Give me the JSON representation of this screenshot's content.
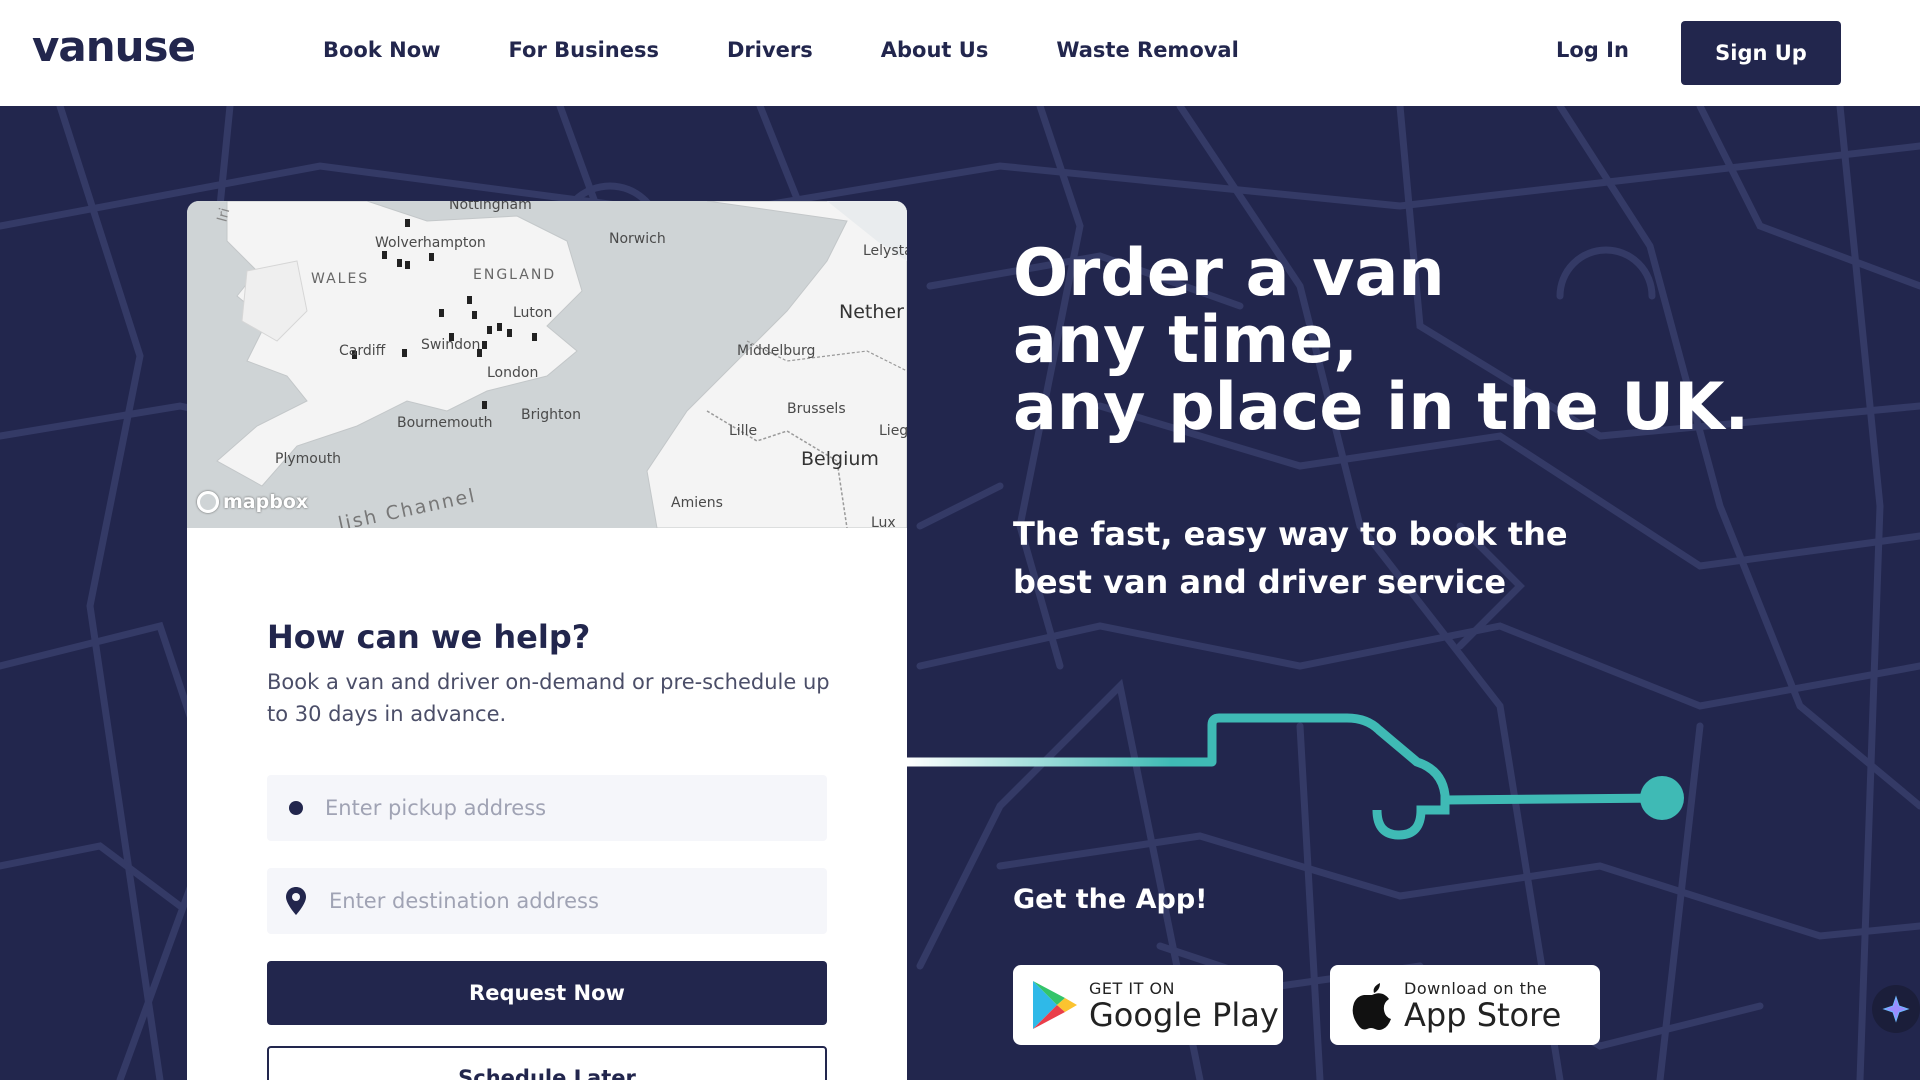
{
  "brand": {
    "logo": "vanuse"
  },
  "nav": {
    "items": [
      "Book Now",
      "For Business",
      "Drivers",
      "About Us",
      "Waste Removal"
    ],
    "login": "Log In",
    "signup": "Sign Up"
  },
  "map": {
    "labels": {
      "nottingham": "Nottingham",
      "wolverhampton": "Wolverhampton",
      "norwich": "Norwich",
      "lelystad": "Lelysta",
      "wales": "WALES",
      "england": "ENGLAND",
      "luton": "Luton",
      "netherlands": "Nether",
      "cardiff": "Cardiff",
      "swindon": "Swindon",
      "london": "London",
      "middelburg": "Middelburg",
      "brussels": "Brussels",
      "lille": "Lille",
      "liege": "Lieg",
      "belgium": "Belgium",
      "bournemouth": "Bournemouth",
      "brighton": "Brighton",
      "plymouth": "Plymouth",
      "channel": "lish Channel",
      "amiens": "Amiens",
      "lux": "Lux",
      "irish": "Iri"
    },
    "attribution": "mapbox"
  },
  "form": {
    "title": "How can we help?",
    "subtitle": "Book a van and driver on-demand or pre-schedule up to 30 days in advance.",
    "pickup_placeholder": "Enter pickup address",
    "destination_placeholder": "Enter destination address",
    "request_label": "Request Now",
    "schedule_label": "Schedule Later"
  },
  "hero": {
    "headline_lines": [
      "Order a van",
      "any time,",
      "any place in the UK."
    ],
    "subhead": "The fast, easy way to book the best van and driver service"
  },
  "app": {
    "heading": "Get the App!",
    "google_small": "GET IT ON",
    "google_big": "Google Play",
    "apple_small": "Download on the",
    "apple_big": "App Store"
  },
  "colors": {
    "navy": "#22264d",
    "teal": "#3fbab5",
    "white": "#ffffff"
  },
  "icons": [
    "pickup-dot-icon",
    "location-pin-icon",
    "google-play-icon",
    "apple-icon",
    "assistant-sparkle-icon",
    "mapbox-logo-icon"
  ]
}
